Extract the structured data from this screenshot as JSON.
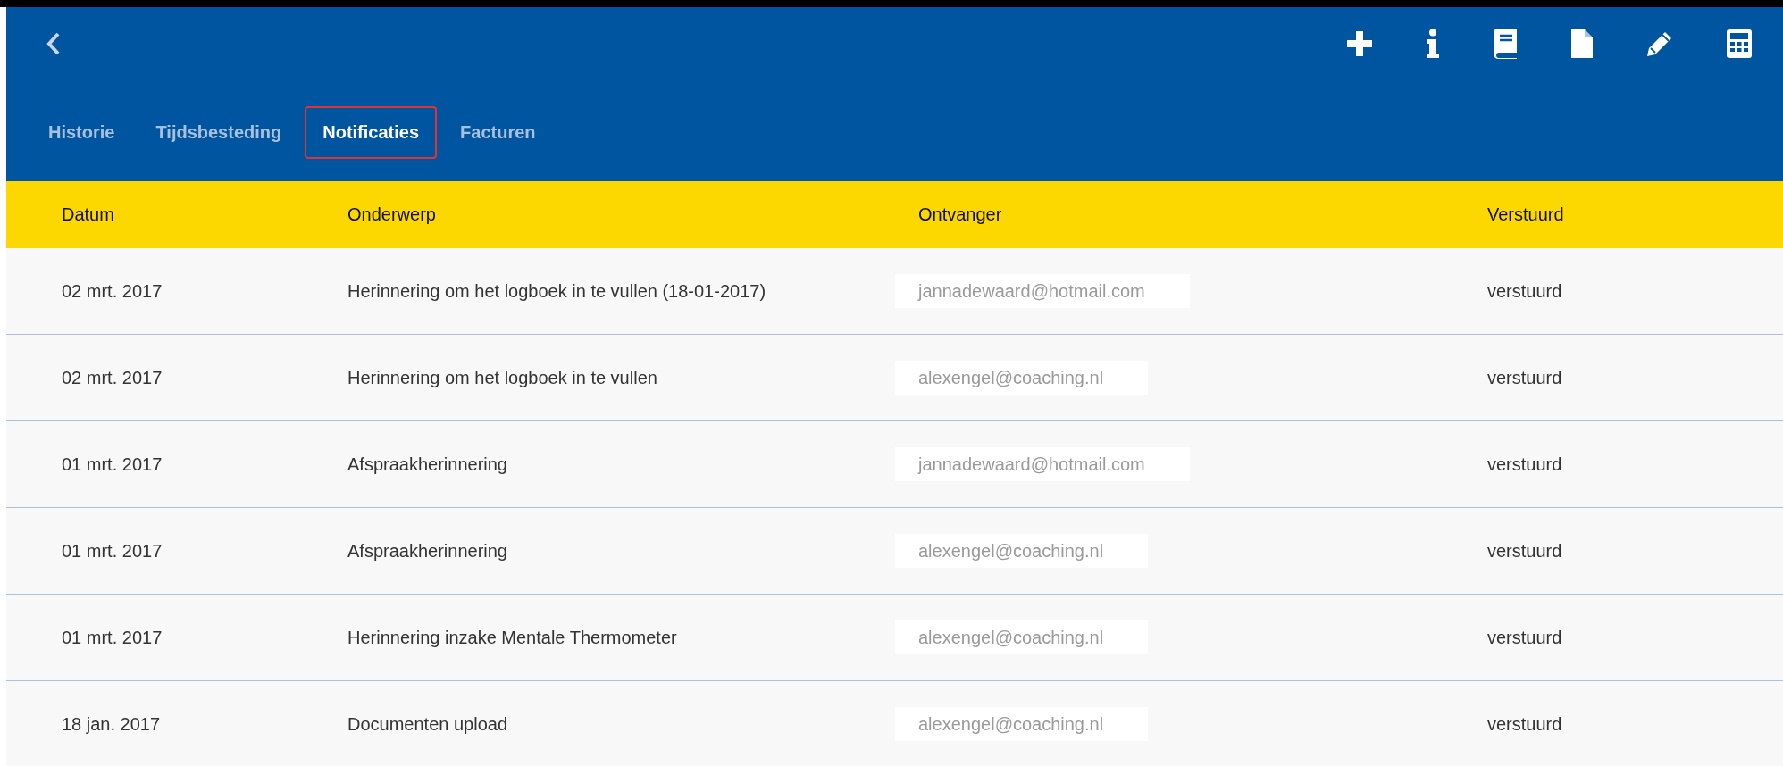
{
  "tabs": [
    {
      "label": "Historie",
      "selected": false
    },
    {
      "label": "Tijdsbesteding",
      "selected": false
    },
    {
      "label": "Notificaties",
      "selected": true
    },
    {
      "label": "Facturen",
      "selected": false
    }
  ],
  "table": {
    "columns": [
      "Datum",
      "Onderwerp",
      "Ontvanger",
      "Verstuurd"
    ],
    "rows": [
      {
        "date": "02 mrt. 2017",
        "subject": "Herinnering om het logboek in te vullen (18-01-2017)",
        "recipient": "jannadewaard@hotmail.com",
        "status": "verstuurd"
      },
      {
        "date": "02 mrt. 2017",
        "subject": "Herinnering om het logboek in te vullen",
        "recipient": "alexengel@coaching.nl",
        "status": "verstuurd"
      },
      {
        "date": "01 mrt. 2017",
        "subject": "Afspraakherinnering",
        "recipient": "jannadewaard@hotmail.com",
        "status": "verstuurd"
      },
      {
        "date": "01 mrt. 2017",
        "subject": "Afspraakherinnering",
        "recipient": "alexengel@coaching.nl",
        "status": "verstuurd"
      },
      {
        "date": "01 mrt. 2017",
        "subject": "Herinnering inzake Mentale Thermometer",
        "recipient": "alexengel@coaching.nl",
        "status": "verstuurd"
      },
      {
        "date": "18 jan. 2017",
        "subject": "Documenten upload",
        "recipient": "alexengel@coaching.nl",
        "status": "verstuurd"
      }
    ]
  }
}
